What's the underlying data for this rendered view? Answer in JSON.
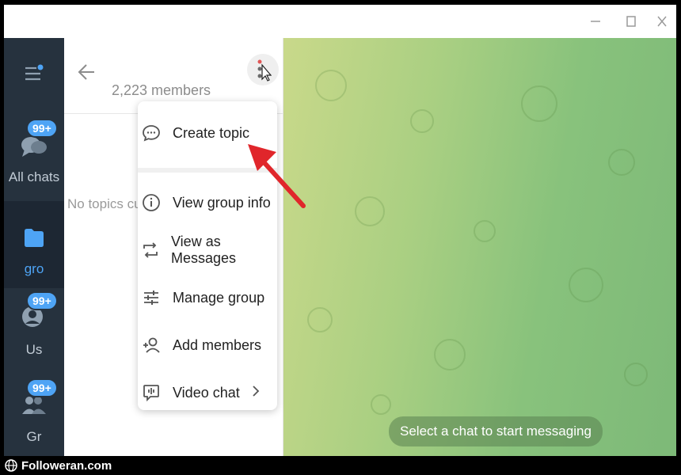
{
  "window": {
    "controls": [
      "minimize-icon",
      "maximize-icon",
      "close-icon"
    ]
  },
  "sidebar": {
    "folders": [
      {
        "label": "All chats",
        "badge": "99+",
        "icon": "chats-icon",
        "active": false
      },
      {
        "label": "gro",
        "badge": "",
        "icon": "folder-icon",
        "active": true
      },
      {
        "label": "Us",
        "badge": "99+",
        "icon": "user-icon",
        "active": false
      },
      {
        "label": "Gr",
        "badge": "99+",
        "icon": "group-icon",
        "active": false
      }
    ]
  },
  "panel": {
    "members": "2,223 members",
    "empty_text": "No topics curr"
  },
  "menu": {
    "items": [
      {
        "label": "Create topic",
        "icon": "chat-bubble-icon"
      },
      {
        "label": "View group info",
        "icon": "info-icon"
      },
      {
        "label": "View as Messages",
        "icon": "switch-icon"
      },
      {
        "label": "Manage group",
        "icon": "sliders-icon"
      },
      {
        "label": "Add members",
        "icon": "add-user-icon"
      },
      {
        "label": "Video chat",
        "icon": "video-chat-icon"
      }
    ]
  },
  "chat": {
    "empty_state": "Select a chat to start messaging"
  },
  "footer": {
    "watermark": "Followeran.com"
  },
  "colors": {
    "accent": "#4ea4f5",
    "sidebar_bg": "#26323e",
    "arrow": "#e0262b"
  }
}
